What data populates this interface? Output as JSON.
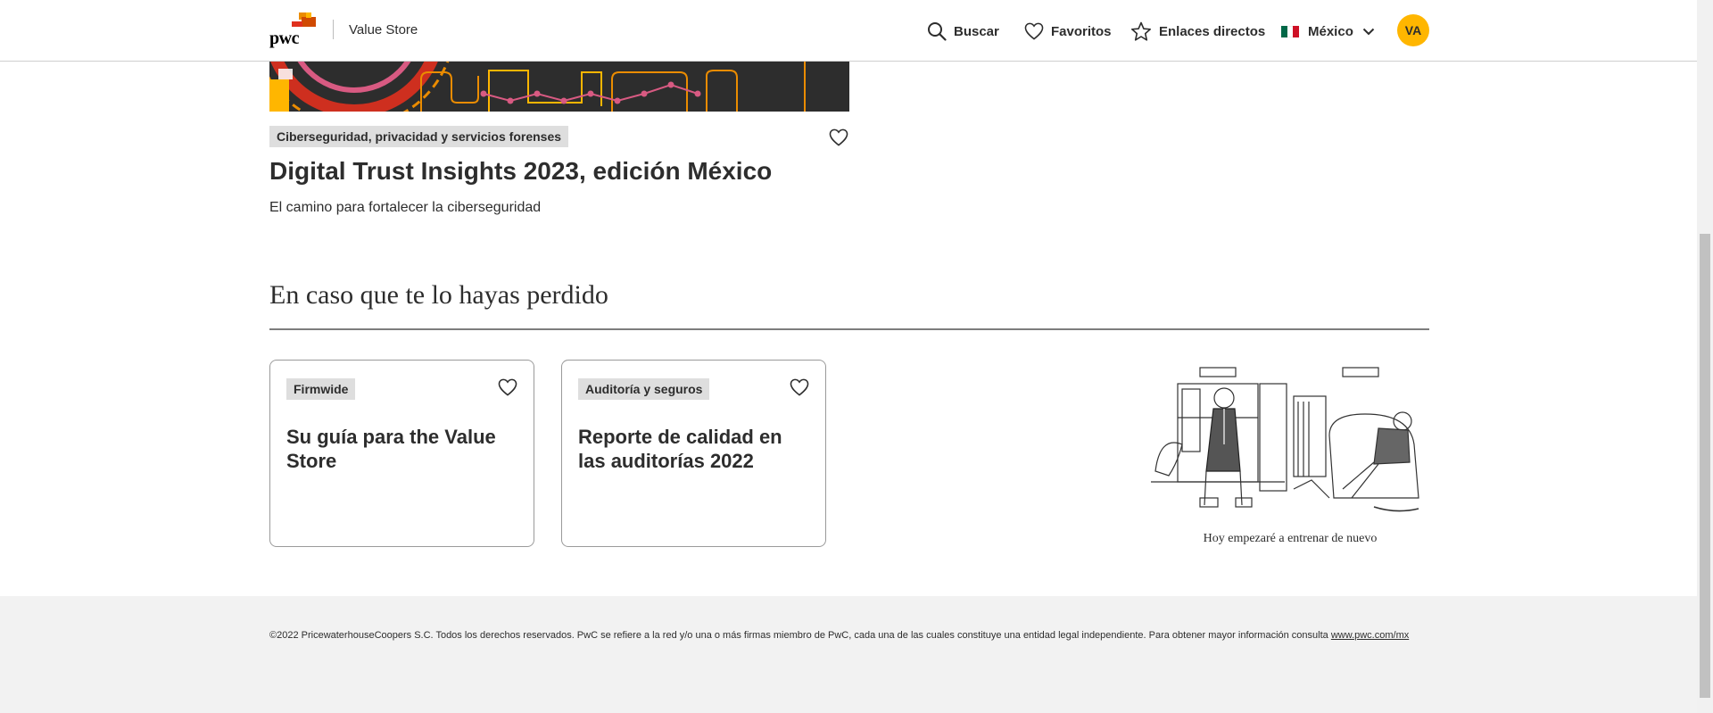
{
  "header": {
    "logo_text": "pwc",
    "store_name": "Value Store",
    "nav": {
      "search": "Buscar",
      "favorites": "Favoritos",
      "links": "Enlaces directos",
      "country": "México"
    },
    "avatar_initials": "VA",
    "accent_color": "#ffb600"
  },
  "featured": {
    "tag": "Ciberseguridad, privacidad y servicios forenses",
    "title": "Digital Trust Insights 2023, edición México",
    "subtitle": "El camino para fortalecer la ciberseguridad"
  },
  "section": {
    "title": "En caso que te lo hayas perdido",
    "cards": [
      {
        "tag": "Firmwide",
        "title": "Su guía para the Value Store"
      },
      {
        "tag": "Auditoría y seguros",
        "title": "Reporte de calidad en las auditorías 2022"
      }
    ],
    "cartoon_caption": "Hoy empezaré a entrenar de nuevo"
  },
  "footer": {
    "text": "©2022 PricewaterhouseCoopers S.C. Todos los derechos reservados. PwC se refiere a la red y/o una o más firmas miembro de PwC, cada una de las cuales constituye una entidad legal independiente. Para obtener mayor información consulta",
    "link": "www.pwc.com/mx"
  }
}
